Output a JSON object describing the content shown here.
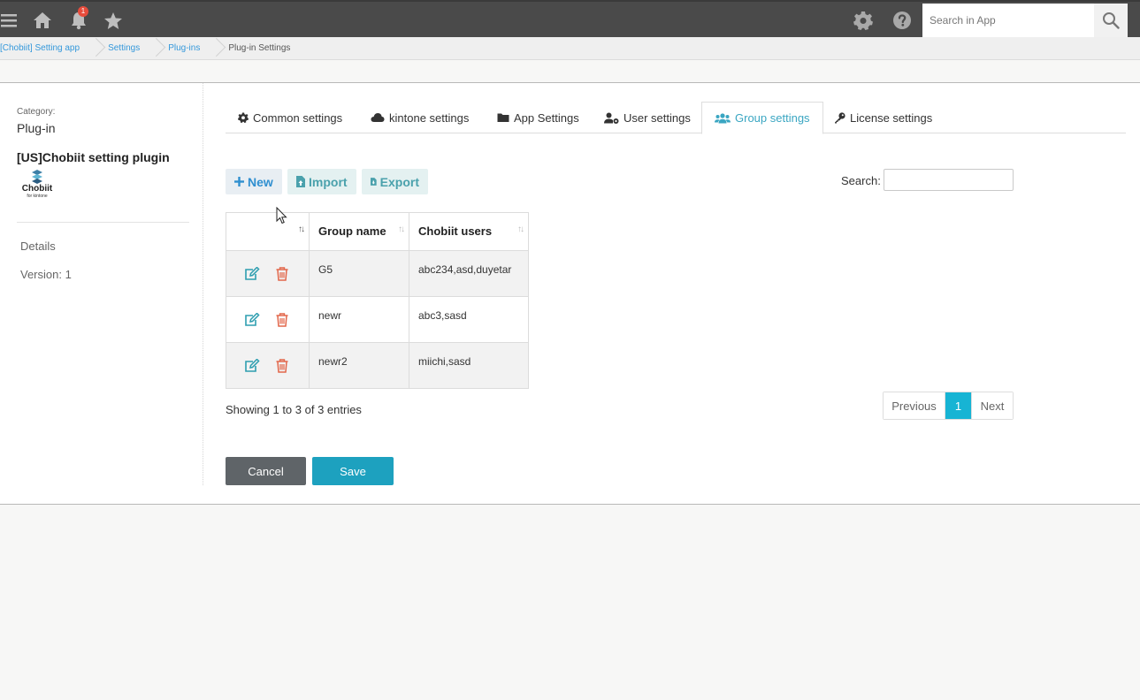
{
  "topbar": {
    "notification_count": "1",
    "search_placeholder": "Search in App"
  },
  "breadcrumb": [
    "[Chobiit] Setting app",
    "Settings",
    "Plug-ins",
    "Plug-in Settings"
  ],
  "sidebar": {
    "category_label": "Category:",
    "category_value": "Plug-in",
    "plugin_name": "[US]Chobiit setting plugin",
    "logo_text": "Chobiit",
    "logo_sub": "for kintone",
    "details": "Details",
    "version": "Version: 1"
  },
  "tabs": [
    {
      "label": "Common settings",
      "icon": "gear-icon"
    },
    {
      "label": "kintone settings",
      "icon": "cloud-icon"
    },
    {
      "label": "App Settings",
      "icon": "folder-icon"
    },
    {
      "label": "User settings",
      "icon": "user-cog-icon"
    },
    {
      "label": "Group settings",
      "icon": "users-icon",
      "active": true
    },
    {
      "label": "License settings",
      "icon": "key-icon"
    }
  ],
  "toolbar": {
    "new_label": "New",
    "import_label": "Import",
    "export_label": "Export",
    "search_label": "Search:"
  },
  "table": {
    "headers": [
      "",
      "Group name",
      "Chobiit users"
    ],
    "rows": [
      {
        "group": "G5",
        "users": "abc234,asd,duyetar"
      },
      {
        "group": "newr",
        "users": "abc3,sasd"
      },
      {
        "group": "newr2",
        "users": "miichi,sasd"
      }
    ]
  },
  "footer": {
    "info": "Showing 1 to 3 of 3 entries",
    "prev": "Previous",
    "page": "1",
    "next": "Next",
    "cancel": "Cancel",
    "save": "Save"
  },
  "colors": {
    "accent": "#1da1bf",
    "tab_active": "#3aa6c2",
    "delete": "#e2664a",
    "edit": "#2e9eb0"
  }
}
